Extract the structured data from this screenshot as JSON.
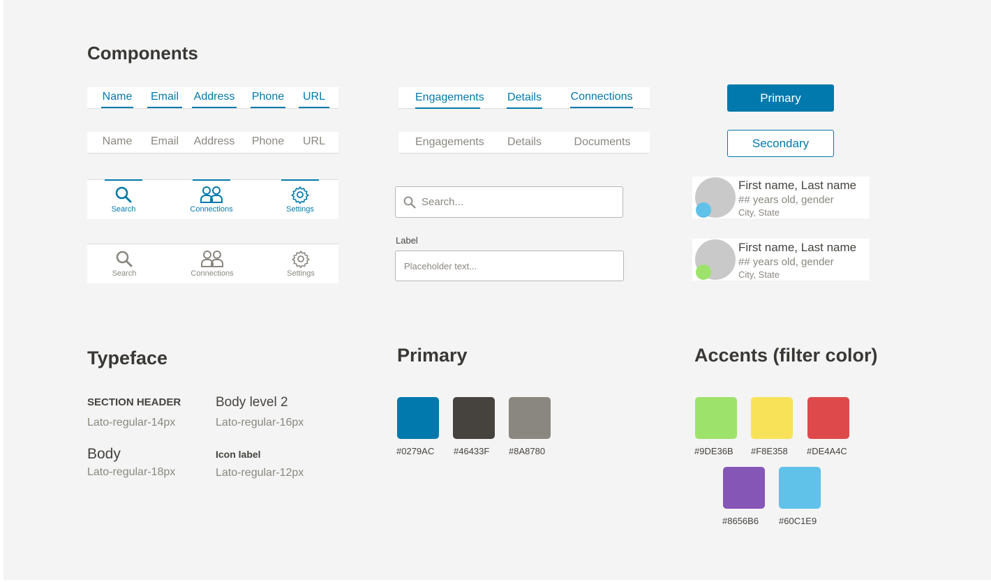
{
  "components_title": "Components",
  "field_tabs_active": [
    "Name",
    "Email",
    "Address",
    "Phone",
    "URL"
  ],
  "field_tabs_inactive": [
    "Name",
    "Email",
    "Address",
    "Phone",
    "URL"
  ],
  "section_tabs_active": [
    "Engagements",
    "Details",
    "Connections"
  ],
  "section_tabs_inactive": [
    "Engagements",
    "Details",
    "Documents"
  ],
  "icon_nav_active": [
    {
      "label": "Search",
      "icon": "search-icon"
    },
    {
      "label": "Connections",
      "icon": "connections-icon"
    },
    {
      "label": "Settings",
      "icon": "settings-icon"
    }
  ],
  "icon_nav_inactive": [
    {
      "label": "Search",
      "icon": "search-icon"
    },
    {
      "label": "Connections",
      "icon": "connections-icon"
    },
    {
      "label": "Settings",
      "icon": "settings-icon"
    }
  ],
  "buttons": {
    "primary": "Primary",
    "secondary": "Secondary"
  },
  "search": {
    "placeholder": "Search..."
  },
  "field": {
    "label": "Label",
    "placeholder": "Placeholder text..."
  },
  "profiles": [
    {
      "name": "First name, Last name",
      "meta": "## years old, gender",
      "location": "City, State",
      "status_color": "#60C1E9"
    },
    {
      "name": "First name, Last name",
      "meta": "## years old, gender",
      "location": "City, State",
      "status_color": "#9DE36B"
    }
  ],
  "typeface": {
    "title": "Typeface",
    "section_header": {
      "sample": "SECTION HEADER",
      "spec": "Lato-regular-14px"
    },
    "body_level_2": {
      "sample": "Body level 2",
      "spec": "Lato-regular-16px"
    },
    "body": {
      "sample": "Body",
      "spec": "Lato-regular-18px"
    },
    "icon_label": {
      "sample": "Icon label",
      "spec": "Lato-regular-12px"
    }
  },
  "primary_palette": {
    "title": "Primary",
    "colors": [
      "#0279AC",
      "#46433F",
      "#8A8780"
    ]
  },
  "accent_palette": {
    "title": "Accents (filter color)",
    "colors": [
      "#9DE36B",
      "#F8E358",
      "#DE4A4C",
      "#8656B6",
      "#60C1E9"
    ]
  }
}
